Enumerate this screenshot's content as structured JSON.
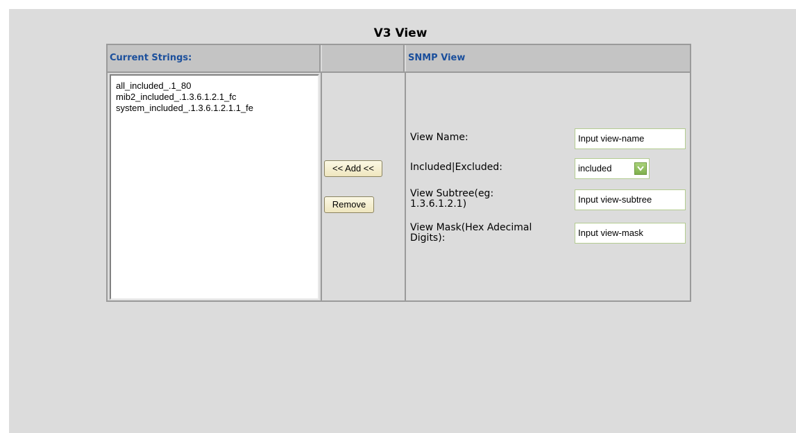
{
  "page_title": "V3 View",
  "table": {
    "header_current": "Current Strings:",
    "header_snmp": "SNMP View"
  },
  "current_strings": [
    "all_included_.1_80",
    "mib2_included_.1.3.6.1.2.1_fc",
    "system_included_.1.3.6.1.2.1.1_fe"
  ],
  "buttons": {
    "add": "<< Add <<",
    "remove": "Remove"
  },
  "form": {
    "view_name_label": "View Name:",
    "view_name_value": "Input view-name",
    "included_label": "Included|Excluded:",
    "included_value": "included",
    "subtree_label_line1": "View Subtree(eg:",
    "subtree_label_line2": "1.3.6.1.2.1)",
    "subtree_value": "Input view-subtree",
    "mask_label_line1": "View Mask(Hex Adecimal",
    "mask_label_line2": "Digits):",
    "mask_value": "Input view-mask"
  },
  "colors": {
    "header_text": "#1b4f9c",
    "header_bg": "#c4c4c4",
    "panel_bg": "#dcdcdc",
    "button_bg": "#efe6bf",
    "select_arrow": "#7fb04c"
  },
  "icons": {
    "select_arrow": "chevron-down-icon"
  }
}
